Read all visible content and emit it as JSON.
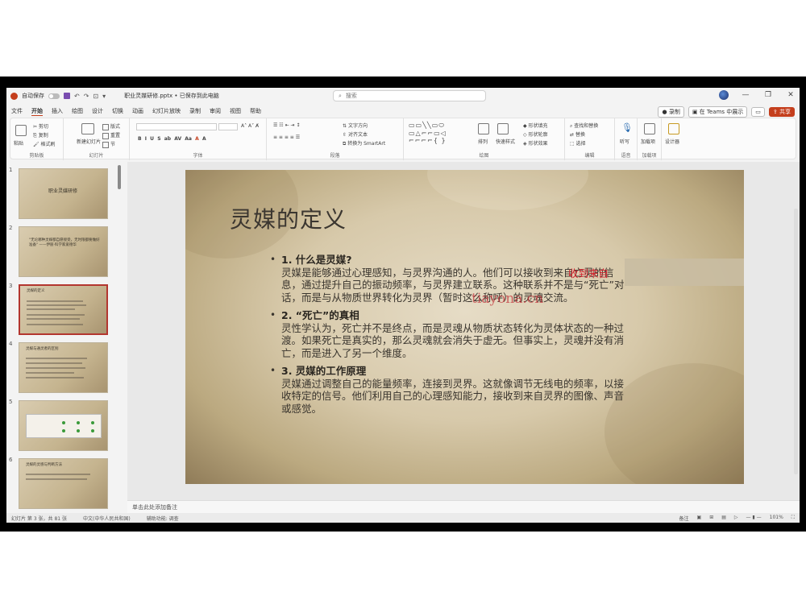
{
  "titlebar": {
    "autosave_label": "自动保存",
    "doc_title": "职业灵媒研修.pptx • 已保存到此电脑",
    "search_placeholder": "搜索"
  },
  "menu": {
    "tabs": [
      "文件",
      "开始",
      "插入",
      "绘图",
      "设计",
      "切换",
      "动画",
      "幻灯片放映",
      "录制",
      "审阅",
      "视图",
      "帮助"
    ],
    "active_tab": "开始",
    "record_label": "录制",
    "teams_label": "在 Teams 中展示",
    "share_label": "共享"
  },
  "ribbon": {
    "clipboard": {
      "paste": "粘贴",
      "cut": "剪切",
      "copy": "复制",
      "format_painter": "格式刷",
      "label": "剪贴板"
    },
    "slides": {
      "new_slide": "新建幻灯片",
      "layout": "版式",
      "reset": "重置",
      "section": "节",
      "label": "幻灯片"
    },
    "font": {
      "label": "字体"
    },
    "paragraph": {
      "text_direction": "文字方向",
      "align_text": "对齐文本",
      "smartart": "转换为 SmartArt",
      "label": "段落"
    },
    "drawing": {
      "arrange": "排列",
      "quick_styles": "快速样式",
      "shape_fill": "形状填充",
      "shape_outline": "形状轮廓",
      "shape_effects": "形状效果",
      "label": "绘图"
    },
    "editing": {
      "find": "查找和替换",
      "replace": "替换",
      "select": "选择",
      "label": "编辑"
    },
    "voice": {
      "dictate": "听写",
      "label": "语音"
    },
    "addins": {
      "addins": "加载项",
      "label": "加载项"
    },
    "designer": {
      "label": "设计器"
    }
  },
  "thumbnails": [
    {
      "num": "1",
      "title": "职业灵媒研修"
    },
    {
      "num": "2",
      "title": "\"无论哪种灵媒都自愿接受，无时限都要做好准备\" ——伊丽·科学家爱德华"
    },
    {
      "num": "3",
      "title": "灵媒的定义"
    },
    {
      "num": "4",
      "title": "灵媒与通灵者的区别"
    },
    {
      "num": "5",
      "title": ""
    },
    {
      "num": "6",
      "title": "灵媒的灵感与判断方法"
    }
  ],
  "slide": {
    "title": "灵媒的定义",
    "items": [
      {
        "head": "1. 什么是灵媒?",
        "body": "灵媒是能够通过心理感知，与灵界沟通的人。他们可以接收到来自亡灵的信息，通过提升自己的振动频率，与灵界建立联系。这种联系并不是与“死亡”对话，而是与从物质世界转化为灵界（暂时这么称呼）的灵魂交流。"
      },
      {
        "head": "2. “死亡”的真相",
        "body": "灵性学认为，死亡并不是终点，而是灵魂从物质状态转化为灵体状态的一种过渡。如果死亡是真实的，那么灵魂就会消失于虚无。但事实上，灵魂并没有消亡，而是进入了另一个维度。"
      },
      {
        "head": "3. 灵媒的工作原理",
        "body": "灵媒通过调整自己的能量频率，连接到灵界。这就像调节无线电的频率，以接收特定的信号。他们利用自己的心理感知能力，接收到来自灵界的图像、声音或感觉。"
      }
    ],
    "watermark_red": "收到来自",
    "watermark_site": "tiayona.cn"
  },
  "notes_placeholder": "单击此处添加备注",
  "status": {
    "slide_info": "幻灯片 第 3 张，共 81 张",
    "language": "中文(中华人民共和国)",
    "accessibility": "辅助功能: 调查",
    "notes_btn": "备注",
    "zoom": "101%"
  },
  "colors": {
    "accent": "#c43e1c",
    "selected_thumb": "#b3362f",
    "watermark": "#d3212d"
  }
}
